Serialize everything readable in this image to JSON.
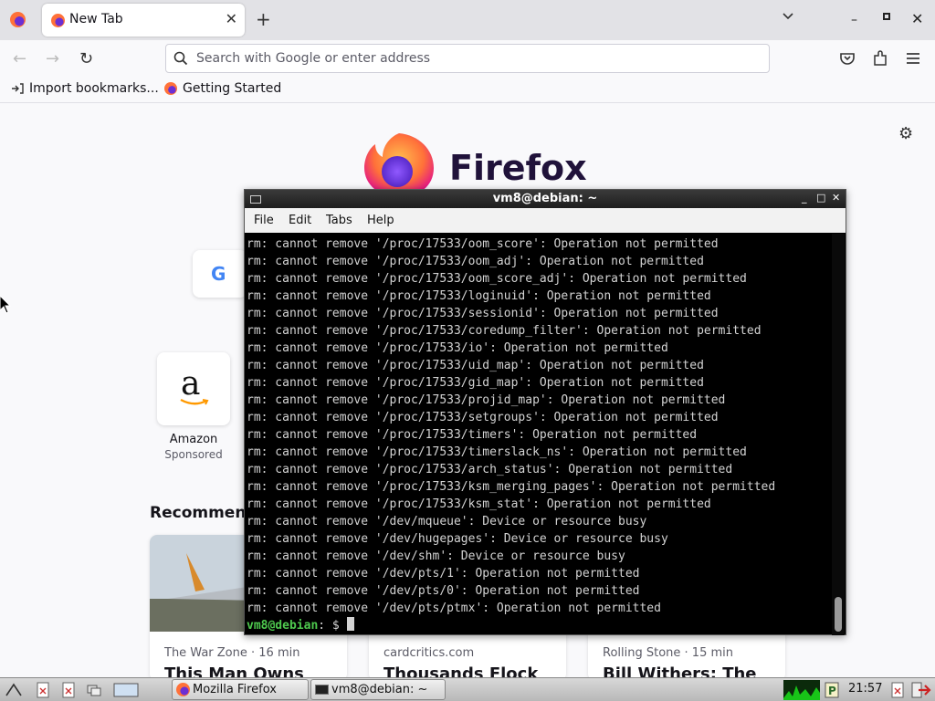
{
  "browser": {
    "tab": {
      "title": "New Tab",
      "close_glyph": "✕"
    },
    "new_tab_glyph": "+",
    "url_placeholder": "Search with Google or enter address",
    "bookmarks": [
      {
        "label": "Import bookmarks...",
        "icon": "import-icon"
      },
      {
        "label": "Getting Started",
        "icon": "firefox-icon"
      }
    ],
    "nav": {
      "back": "←",
      "forward": "→",
      "reload": "↻"
    },
    "window_controls": {
      "minimize": "–",
      "close": "✕"
    }
  },
  "newtab": {
    "brand": "Firefox",
    "shortcut": {
      "label": "Amazon",
      "sub": "Sponsored",
      "glyph": "a"
    },
    "google_glyph": "G",
    "recommended_heading": "Recommended by Pocket",
    "cards": [
      {
        "source": "The War Zone · 16 min",
        "title": "This Man Owns"
      },
      {
        "source": "cardcritics.com",
        "title": "Thousands Flock"
      },
      {
        "source": "Rolling Stone · 15 min",
        "title": "Bill Withers: The"
      }
    ],
    "gear_glyph": "⚙"
  },
  "terminal": {
    "title": "vm8@debian: ~",
    "menu": [
      "File",
      "Edit",
      "Tabs",
      "Help"
    ],
    "lines": [
      "rm: cannot remove '/proc/17533/oom_score': Operation not permitted",
      "rm: cannot remove '/proc/17533/oom_adj': Operation not permitted",
      "rm: cannot remove '/proc/17533/oom_score_adj': Operation not permitted",
      "rm: cannot remove '/proc/17533/loginuid': Operation not permitted",
      "rm: cannot remove '/proc/17533/sessionid': Operation not permitted",
      "rm: cannot remove '/proc/17533/coredump_filter': Operation not permitted",
      "rm: cannot remove '/proc/17533/io': Operation not permitted",
      "rm: cannot remove '/proc/17533/uid_map': Operation not permitted",
      "rm: cannot remove '/proc/17533/gid_map': Operation not permitted",
      "rm: cannot remove '/proc/17533/projid_map': Operation not permitted",
      "rm: cannot remove '/proc/17533/setgroups': Operation not permitted",
      "rm: cannot remove '/proc/17533/timers': Operation not permitted",
      "rm: cannot remove '/proc/17533/timerslack_ns': Operation not permitted",
      "rm: cannot remove '/proc/17533/arch_status': Operation not permitted",
      "rm: cannot remove '/proc/17533/ksm_merging_pages': Operation not permitted",
      "rm: cannot remove '/proc/17533/ksm_stat': Operation not permitted",
      "rm: cannot remove '/dev/mqueue': Device or resource busy",
      "rm: cannot remove '/dev/hugepages': Device or resource busy",
      "rm: cannot remove '/dev/shm': Device or resource busy",
      "rm: cannot remove '/dev/pts/1': Operation not permitted",
      "rm: cannot remove '/dev/pts/0': Operation not permitted",
      "rm: cannot remove '/dev/pts/ptmx': Operation not permitted"
    ],
    "prompt_user": "vm8@debian",
    "prompt_sep": ": $ ",
    "scroll_position": 1.0
  },
  "taskbar": {
    "tasks": [
      {
        "label": "Mozilla Firefox",
        "icon": "firefox-icon"
      },
      {
        "label": "vm8@debian: ~",
        "icon": "terminal-icon"
      }
    ],
    "clock": "21:57"
  }
}
